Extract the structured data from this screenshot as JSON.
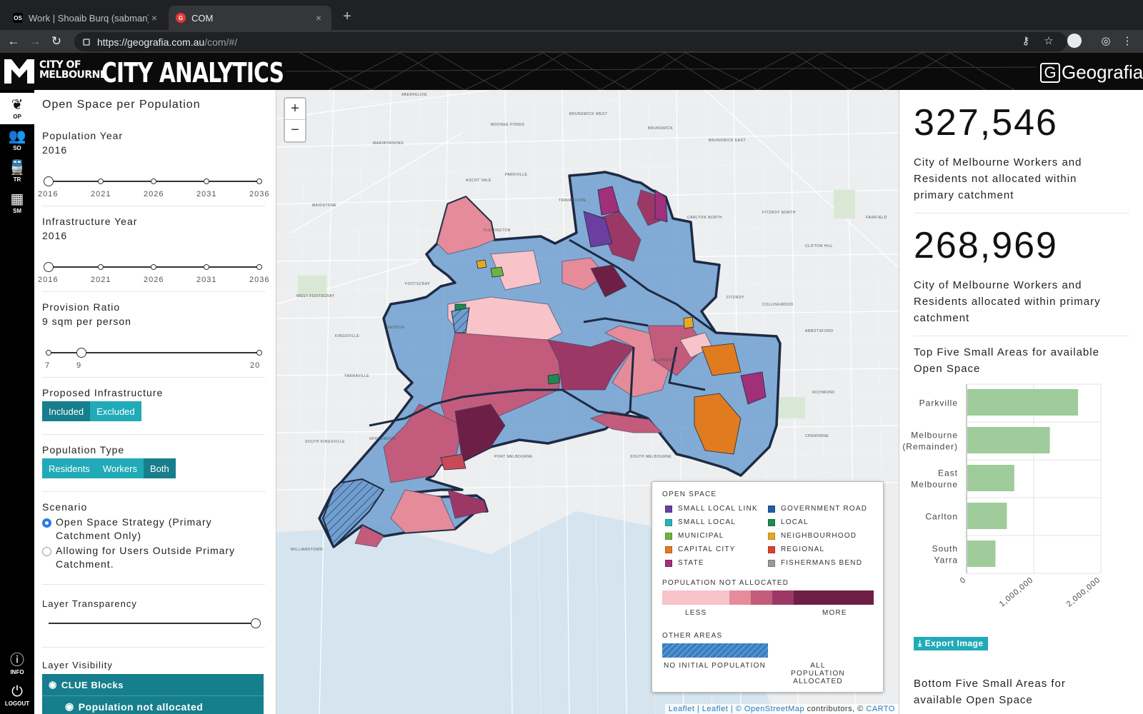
{
  "browser": {
    "tabs": [
      {
        "favicon": "OS",
        "title": "Work | Shoaib Burq (sabman) -",
        "close": "×"
      },
      {
        "favicon": "G",
        "title": "COM",
        "close": "×"
      }
    ],
    "new_tab": "+",
    "url_host": "https://geografia.com.au",
    "url_path": "/com/#/"
  },
  "header": {
    "logo_line1": "CITY OF",
    "logo_line2": "MELBOURNE",
    "title": "CITY ANALYTICS",
    "brand": "Geografia",
    "brand_box": "G"
  },
  "iconbar": [
    {
      "icon": "leaf-icon",
      "label": "OP"
    },
    {
      "icon": "people-icon",
      "label": "SO"
    },
    {
      "icon": "train-icon",
      "label": "TR"
    },
    {
      "icon": "grid-icon",
      "label": "SM"
    },
    {
      "icon": "info-icon",
      "label": "INFO"
    },
    {
      "icon": "power-icon",
      "label": "LOGOUT"
    }
  ],
  "panel": {
    "title": "Open Space per Population",
    "population_year": {
      "label": "Population Year",
      "value": "2016",
      "ticks": [
        "2016",
        "2021",
        "2026",
        "2031",
        "2036"
      ]
    },
    "infrastructure_year": {
      "label": "Infrastructure Year",
      "value": "2016",
      "ticks": [
        "2016",
        "2021",
        "2026",
        "2031",
        "2036"
      ]
    },
    "provision_ratio": {
      "label": "Provision Ratio",
      "value": "9 sqm per person",
      "ticks": [
        "7",
        "9",
        "20"
      ],
      "current": 9,
      "min": 7,
      "max": 20
    },
    "proposed_infrastructure": {
      "label": "Proposed Infrastructure",
      "options": [
        "Included",
        "Excluded"
      ],
      "selected": "Included"
    },
    "population_type": {
      "label": "Population Type",
      "options": [
        "Residents",
        "Workers",
        "Both"
      ],
      "selected": "Both"
    },
    "scenario": {
      "label": "Scenario",
      "options": [
        {
          "line1": "Open Space Strategy (Primary",
          "line2": "Catchment Only)",
          "checked": true
        },
        {
          "line1": "Allowing for Users Outside Primary",
          "line2": "Catchment.",
          "checked": false
        }
      ]
    },
    "layer_transparency": {
      "label": "Layer Transparency",
      "value": 1.0
    },
    "layer_visibility": {
      "label": "Layer Visibility",
      "items": [
        "CLUE Blocks",
        "Population not allocated"
      ]
    }
  },
  "map": {
    "zoom_in": "+",
    "zoom_out": "−",
    "labels": [
      "ABERFELDIE",
      "MOONEE PONDS",
      "BRUNSWICK WEST",
      "BRUNSWICK",
      "BRUNSWICK EAST",
      "ASCOT VALE",
      "MARIBYRNONG",
      "MAIDSTONE",
      "FLEMINGTON",
      "CARLTON NORTH",
      "FITZROY NORTH",
      "FOOTSCRAY",
      "CLIFTON HILL",
      "WEST FOOTSCRAY",
      "FITZROY",
      "COLLINGWOOD",
      "KINGSVILLE",
      "SEDDON",
      "ABBOTSFORD",
      "YARRAVILLE",
      "MELBOURNE",
      "RICHMOND",
      "SOUTH KINGSVILLE",
      "SPOTSWOOD",
      "PORT MELBOURNE",
      "SOUTH MELBOURNE",
      "CREMORNE",
      "WILLIAMSTOWN",
      "PARKVILLE",
      "TRAVANCORE",
      "FAIRFIELD"
    ],
    "attribution": {
      "prefix": "Leaflet | Leaflet | ©",
      "osm": "OpenStreetMap",
      "contrib": "contributors, ©",
      "carto": "CARTO"
    }
  },
  "legend": {
    "open_space_title": "OPEN SPACE",
    "open_space": [
      {
        "label": "SMALL LOCAL LINK",
        "color": "#6b3fa0"
      },
      {
        "label": "GOVERNMENT ROAD",
        "color": "#1f5fa8"
      },
      {
        "label": "SMALL LOCAL",
        "color": "#2bb3b3"
      },
      {
        "label": "LOCAL",
        "color": "#1f8a4c"
      },
      {
        "label": "MUNICIPAL",
        "color": "#6db33f"
      },
      {
        "label": "NEIGHBOURHOOD",
        "color": "#e8a91f"
      },
      {
        "label": "CAPITAL CITY",
        "color": "#e07b1f"
      },
      {
        "label": "REGIONAL",
        "color": "#d9412b"
      },
      {
        "label": "STATE",
        "color": "#a0307a"
      },
      {
        "label": "FISHERMANS BEND",
        "color": "#999999"
      }
    ],
    "pop_title": "POPULATION NOT ALLOCATED",
    "pop_less": "LESS",
    "pop_more": "MORE",
    "pop_colors": [
      "#f8c3c9",
      "#e58b9a",
      "#c35c7c",
      "#9c3866",
      "#6e1f46"
    ],
    "other_title": "OTHER AREAS",
    "other_left": "NO INITIAL POPULATION",
    "other_right_1": "ALL POPULATION",
    "other_right_2": "ALLOCATED",
    "other_color": "#3a7fc1"
  },
  "stats": [
    {
      "value": "327,546",
      "desc_1": "City of Melbourne Workers and",
      "desc_2": "Residents not allocated within",
      "desc_3": "primary catchment"
    },
    {
      "value": "268,969",
      "desc_1": "City of Melbourne Workers and",
      "desc_2": "Residents allocated within primary",
      "desc_3": "catchment"
    }
  ],
  "top_five_title_1": "Top Five Small Areas for available",
  "top_five_title_2": "Open Space",
  "chart_data": {
    "type": "bar",
    "orientation": "horizontal",
    "categories": [
      "Parkville",
      "Melbourne (Remainder)",
      "East Melbourne",
      "Carlton",
      "South Yarra"
    ],
    "values": [
      1650000,
      1230000,
      700000,
      590000,
      420000
    ],
    "xlim": [
      0,
      2000000
    ],
    "xticks": [
      "0",
      "1,000,000",
      "2,000,000"
    ],
    "color": "#9fcc9a",
    "grid": true
  },
  "export_label": "Export Image",
  "bottom_five_title_1": "Bottom Five Small Areas for",
  "bottom_five_title_2": "available Open Space"
}
